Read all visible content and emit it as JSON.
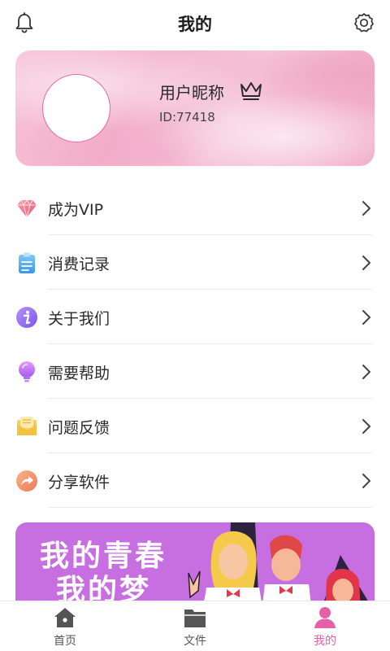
{
  "header": {
    "title": "我的",
    "bell_icon": "bell-icon",
    "settings_icon": "gear-icon"
  },
  "profile": {
    "nickname": "用户昵称",
    "id_text": "ID:77418",
    "crown_icon": "crown-icon"
  },
  "menu": {
    "items": [
      {
        "label": "成为VIP",
        "icon": "diamond-icon",
        "color": "#f0608a"
      },
      {
        "label": "消费记录",
        "icon": "clipboard-icon",
        "color": "#4aa8f0"
      },
      {
        "label": "关于我们",
        "icon": "info-icon",
        "color": "#9a6af0"
      },
      {
        "label": "需要帮助",
        "icon": "lightbulb-icon",
        "color": "#c07af0"
      },
      {
        "label": "问题反馈",
        "icon": "envelope-icon",
        "color": "#f5c040"
      },
      {
        "label": "分享软件",
        "icon": "share-icon",
        "color": "#f29a6a"
      }
    ]
  },
  "banner": {
    "line1": "我的青春",
    "line2": "我的梦",
    "background": "#c76fe0"
  },
  "bottom_nav": {
    "tabs": [
      {
        "label": "首页",
        "icon": "home-icon",
        "active": false
      },
      {
        "label": "文件",
        "icon": "folder-icon",
        "active": false
      },
      {
        "label": "我的",
        "icon": "person-icon",
        "active": true
      }
    ]
  },
  "colors": {
    "accent": "#e65fa8",
    "inactive": "#555555"
  }
}
